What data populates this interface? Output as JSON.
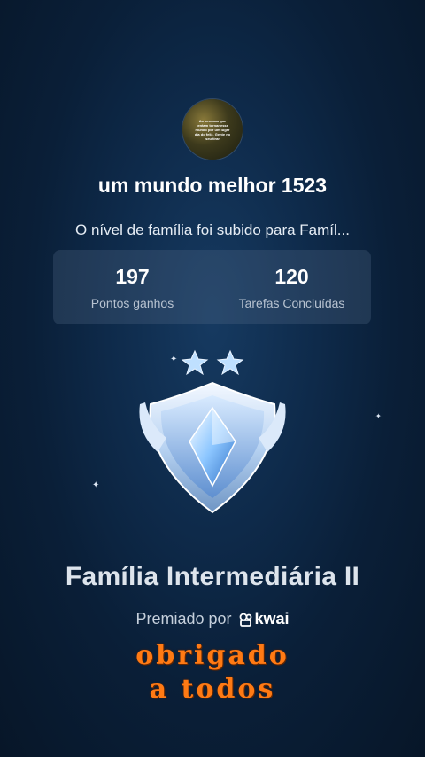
{
  "avatar": {
    "text": "As pessoas que tentam tornar esse mundo por um lugar dia do feliz. Gente no seu tirar"
  },
  "user": {
    "name": "um mundo melhor 1523"
  },
  "message": "O nível de família foi subido para Famíl...",
  "stats": [
    {
      "value": "197",
      "label": "Pontos ganhos"
    },
    {
      "value": "120",
      "label": "Tarefas Concluídas"
    }
  ],
  "badge": {
    "stars": 2,
    "icon": "shield-crystal-icon"
  },
  "level": "Família Intermediária II",
  "award": {
    "label": "Premiado por",
    "brand": "kwai"
  },
  "overlay": {
    "line1": "obrigado",
    "line2": "a todos"
  },
  "colors": {
    "accent": "#ff7a14",
    "background": "#0e2a4a"
  }
}
